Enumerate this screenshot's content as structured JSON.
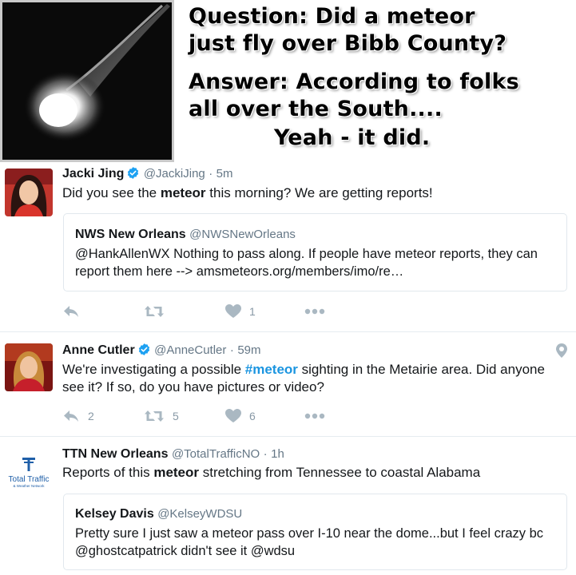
{
  "header": {
    "question_line1": "Question: Did a meteor",
    "question_line2": "just fly over Bibb County?",
    "answer_line1": "Answer: According to folks",
    "answer_line2": "all over the South....",
    "answer_line3": "Yeah - it did."
  },
  "tweets": [
    {
      "name": "Jacki Jing",
      "verified": true,
      "handle": "@JackiJing",
      "separator": "·",
      "time": "5m",
      "text_before": "Did you see the ",
      "text_bold": "meteor",
      "text_after": " this morning? We are getting reports!",
      "quote": {
        "name": "NWS New Orleans",
        "handle": "@NWSNewOrleans",
        "text": "@HankAllenWX Nothing to pass along. If people have meteor reports, they can report them here --> amsmeteors.org/members/imo/re…"
      },
      "actions": {
        "reply": "",
        "retweet": "",
        "like": "1"
      }
    },
    {
      "name": "Anne Cutler",
      "verified": true,
      "handle": "@AnneCutler",
      "separator": "·",
      "time": "59m",
      "text_before": "We're investigating a possible ",
      "text_hashtag": "#meteor",
      "text_after": " sighting in the Metairie area. Did anyone see it? If so, do you have pictures or video?",
      "actions": {
        "reply": "2",
        "retweet": "5",
        "like": "6"
      }
    },
    {
      "name": "TTN New Orleans",
      "verified": false,
      "handle": "@TotalTrafficNO",
      "separator": "·",
      "time": "1h",
      "text_before": "Reports of this ",
      "text_bold": "meteor",
      "text_after": " stretching from Tennessee to coastal Alabama",
      "avatar_logo": {
        "line1": "Total Traffic",
        "line2": "& Weather Network"
      },
      "quote": {
        "name": "Kelsey Davis",
        "handle": "@KelseyWDSU",
        "text": "Pretty sure I just saw a meteor pass over I-10 near the dome...but I feel crazy bc @ghostcatpatrick didn't see it @wdsu"
      }
    }
  ],
  "colors": {
    "text": "#14171a",
    "secondary": "#657786",
    "hashtag": "#1b95e0",
    "verified": "#1da1f2",
    "icon": "#aab8c2",
    "logo_blue": "#1f5fa8"
  },
  "icons": [
    "reply-icon",
    "retweet-icon",
    "like-icon",
    "more-icon",
    "verified-icon",
    "location-pin-icon"
  ]
}
